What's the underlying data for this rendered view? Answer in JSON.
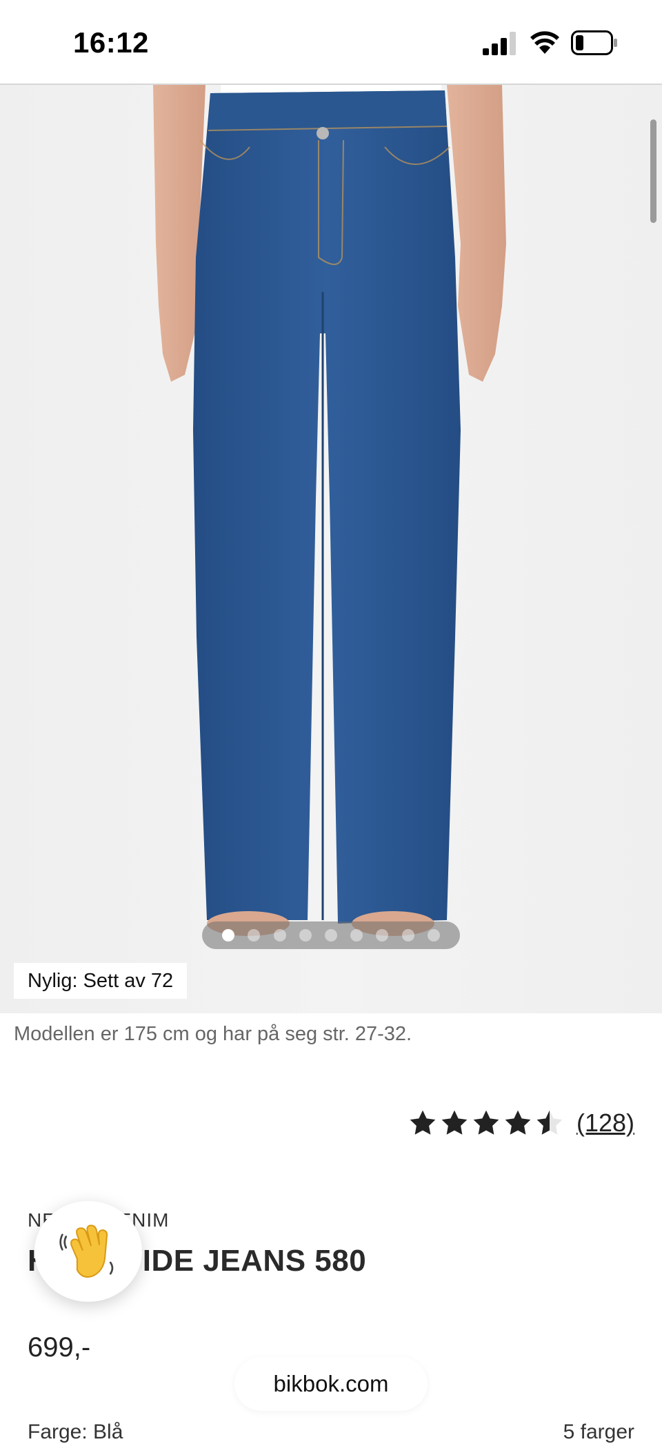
{
  "status_bar": {
    "time": "16:12",
    "icons": [
      "signal-icon",
      "wifi-icon",
      "battery-icon"
    ]
  },
  "gallery": {
    "image_count": 9,
    "active_index": 0,
    "recent_badge": "Nylig: Sett av 72"
  },
  "model_info": "Modellen er 175 cm og har på seg str. 27-32.",
  "rating": {
    "stars": 4.5,
    "max_stars": 5,
    "review_count": "(128)"
  },
  "product": {
    "brand": "NEVER DENIM",
    "name": "HIGH WIDE JEANS 580",
    "price": "699,-",
    "color_label": "Farge: Blå",
    "color_count": "5 farger"
  },
  "chat_button": {
    "icon": "waving-hand-icon"
  },
  "browser": {
    "url": "bikbok.com"
  },
  "colors": {
    "denim": "#2c5a94",
    "background": "#f0f0f0",
    "text": "#222222"
  }
}
